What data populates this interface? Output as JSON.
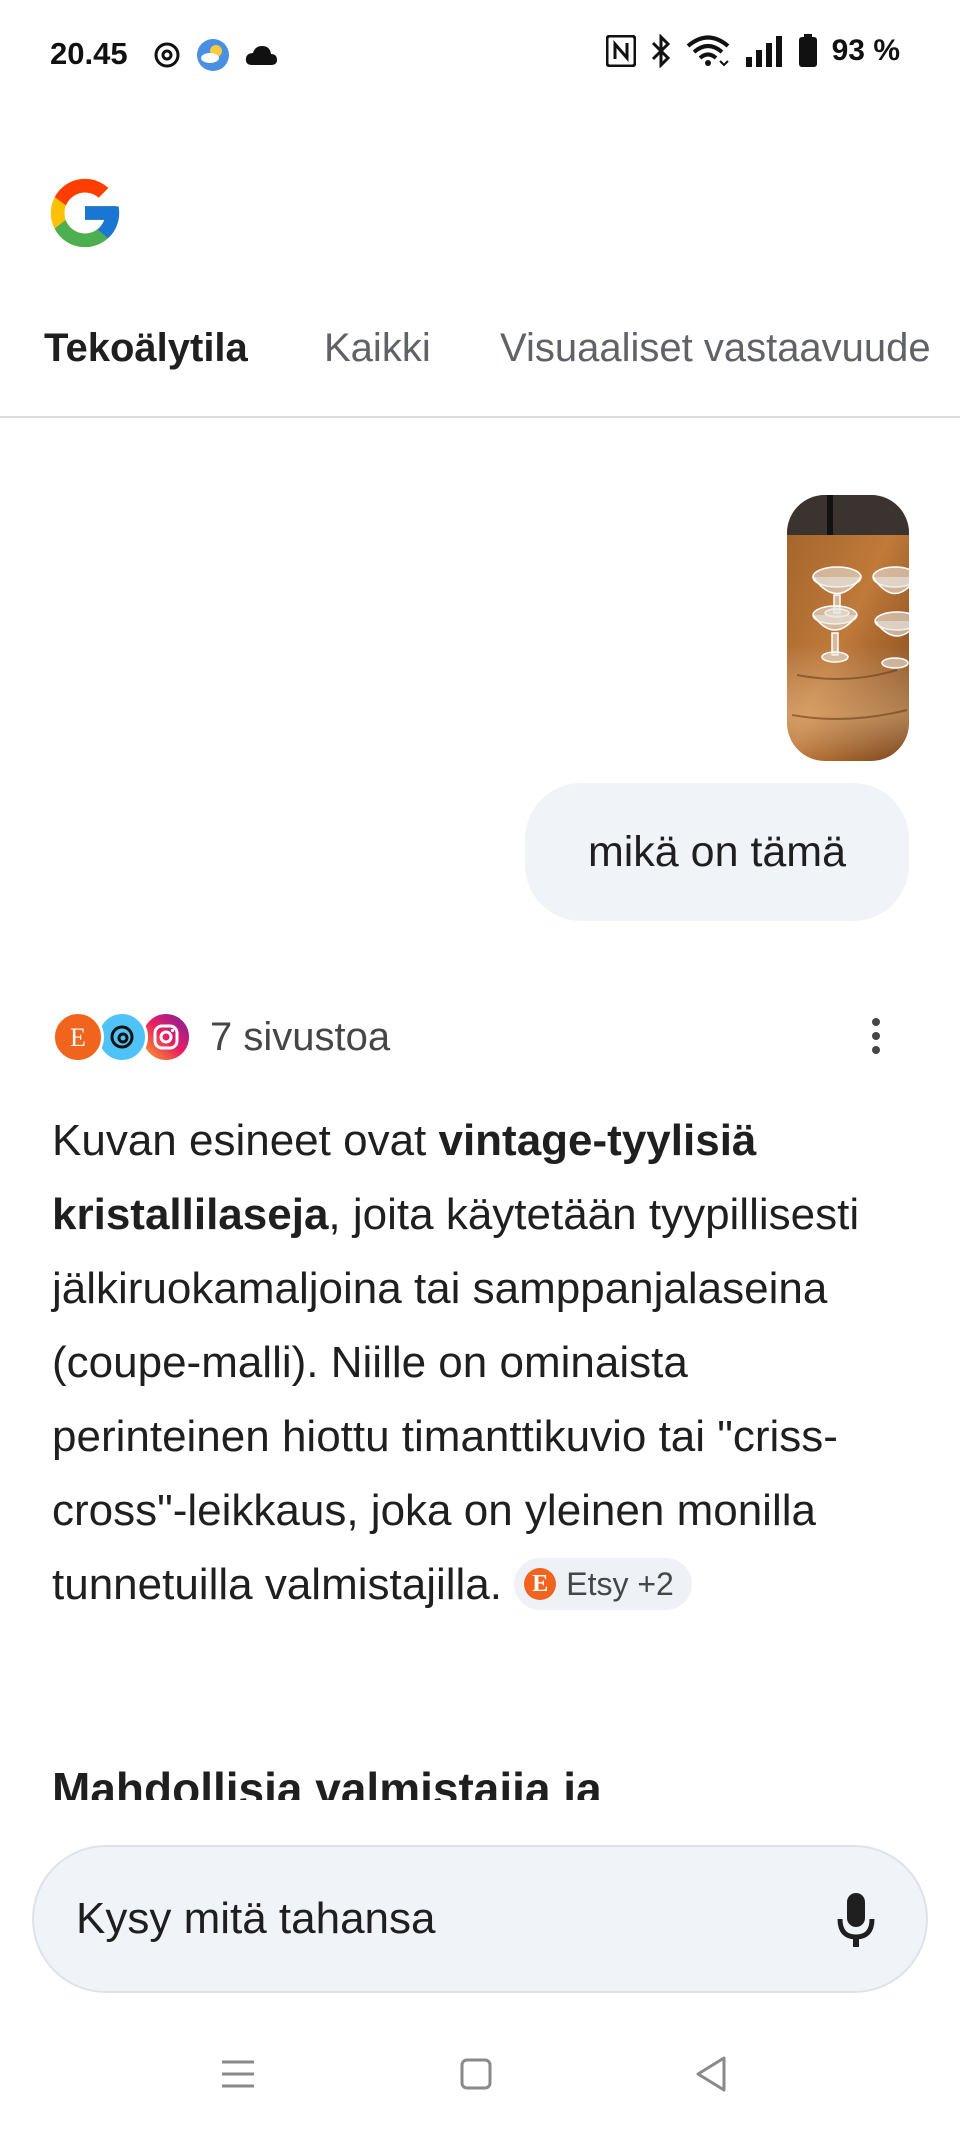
{
  "status_bar": {
    "time": "20.45",
    "battery": "93 %",
    "icons": [
      "threads-icon",
      "weather-icon",
      "cloud-icon",
      "nfc-icon",
      "bluetooth-icon",
      "wifi-icon",
      "signal-icon",
      "battery-icon"
    ]
  },
  "tabs": [
    {
      "label": "Tekoälytila",
      "active": true
    },
    {
      "label": "Kaikki",
      "active": false
    },
    {
      "label": "Visuaaliset vastaavuude",
      "active": false
    }
  ],
  "chat": {
    "user_message": "mikä on tämä",
    "sources_count": "7 sivustoa",
    "source_icons": [
      "etsy-icon",
      "site-icon",
      "instagram-icon"
    ],
    "answer": {
      "part1": "Kuvan esineet ovat ",
      "bold": "vintage-tyylisiä kristallilaseja",
      "part2": ", joita käytetään tyypillisesti jälkiruokamaljoina tai samppanjalaseina (coupe-malli). Niille on ominaista perinteinen hiottu timanttikuvio tai \"criss-cross\"-leikkaus, joka on yleinen monilla tunnetuilla valmistajilla. ",
      "citation": "Etsy +2",
      "citation_letter": "E"
    },
    "section_heading": "Mahdollisia valmistajia ja"
  },
  "ask_bar": {
    "placeholder": "Kysy mitä tahansa"
  },
  "colors": {
    "accent_bg": "#f0f4f9",
    "etsy_orange": "#f1641e",
    "text": "#1f1f1f",
    "muted": "#5f6368"
  }
}
